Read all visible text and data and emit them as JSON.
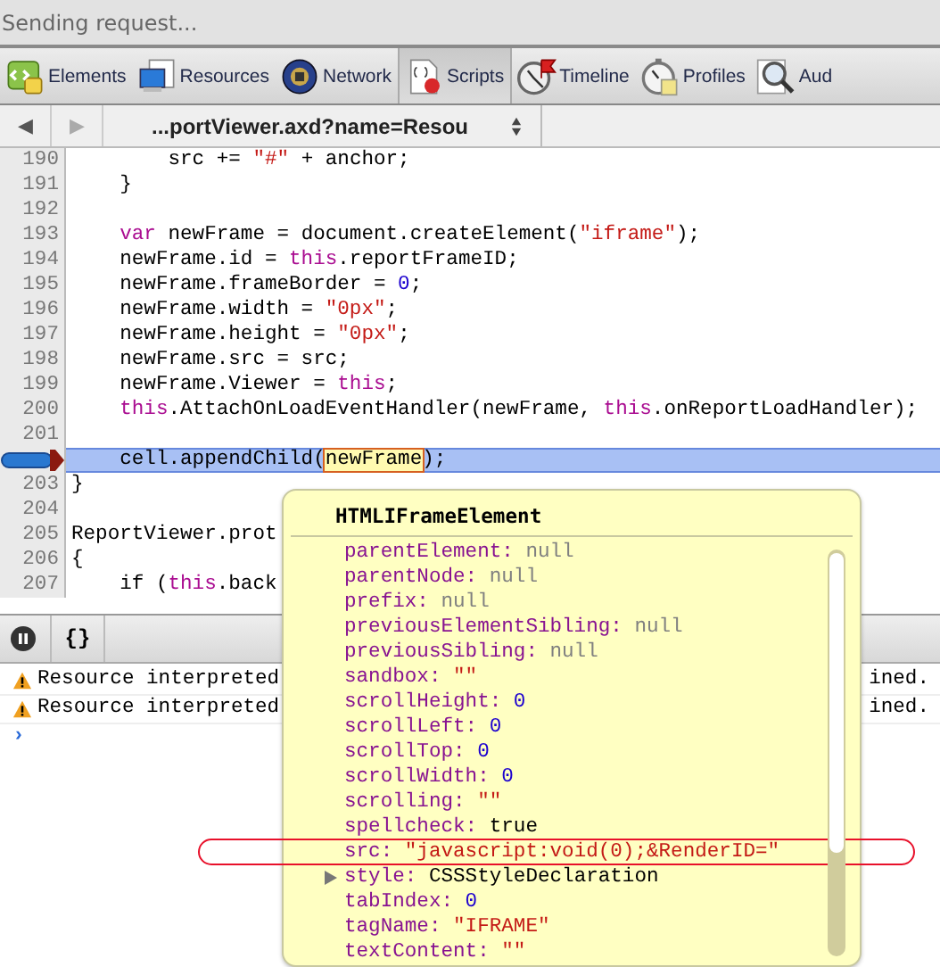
{
  "status_text": "Sending request...",
  "tabs": [
    {
      "label": "Elements",
      "selected": false
    },
    {
      "label": "Resources",
      "selected": false
    },
    {
      "label": "Network",
      "selected": false
    },
    {
      "label": "Scripts",
      "selected": true
    },
    {
      "label": "Timeline",
      "selected": false
    },
    {
      "label": "Profiles",
      "selected": false
    },
    {
      "label": "Aud",
      "selected": false
    }
  ],
  "nav": {
    "back": "◀",
    "forward": "▶",
    "file": "...portViewer.axd?name=Resou"
  },
  "code": {
    "lines": [
      {
        "number": "190",
        "current": false,
        "breakpoint": false,
        "segments": [
          {
            "text": "        src += ",
            "kind": "plain"
          },
          {
            "text": "\"#\"",
            "kind": "string"
          },
          {
            "text": " + anchor;",
            "kind": "plain"
          }
        ]
      },
      {
        "number": "191",
        "current": false,
        "breakpoint": false,
        "segments": [
          {
            "text": "    }",
            "kind": "plain"
          }
        ]
      },
      {
        "number": "192",
        "current": false,
        "breakpoint": false
      },
      {
        "number": "193",
        "current": false,
        "breakpoint": false,
        "segments": [
          {
            "text": "    var",
            "kind": "keyword"
          },
          {
            "text": " newFrame = document.createElement(",
            "kind": "plain"
          },
          {
            "text": "\"iframe\"",
            "kind": "string"
          },
          {
            "text": ");",
            "kind": "plain"
          }
        ]
      },
      {
        "number": "194",
        "current": false,
        "breakpoint": false,
        "segments": [
          {
            "text": "    newFrame.id = ",
            "kind": "plain"
          },
          {
            "text": "this",
            "kind": "keyword"
          },
          {
            "text": ".reportFrameID;",
            "kind": "plain"
          }
        ]
      },
      {
        "number": "195",
        "current": false,
        "breakpoint": false,
        "segments": [
          {
            "text": "    newFrame.frameBorder = ",
            "kind": "plain"
          },
          {
            "text": "0",
            "kind": "number"
          },
          {
            "text": ";",
            "kind": "plain"
          }
        ]
      },
      {
        "number": "196",
        "current": false,
        "breakpoint": false,
        "segments": [
          {
            "text": "    newFrame.width = ",
            "kind": "plain"
          },
          {
            "text": "\"0px\"",
            "kind": "string"
          },
          {
            "text": ";",
            "kind": "plain"
          }
        ]
      },
      {
        "number": "197",
        "current": false,
        "breakpoint": false,
        "segments": [
          {
            "text": "    newFrame.height = ",
            "kind": "plain"
          },
          {
            "text": "\"0px\"",
            "kind": "string"
          },
          {
            "text": ";",
            "kind": "plain"
          }
        ]
      },
      {
        "number": "198",
        "current": false,
        "breakpoint": false,
        "segments": [
          {
            "text": "    newFrame.src = src;",
            "kind": "plain"
          }
        ]
      },
      {
        "number": "199",
        "current": false,
        "breakpoint": false,
        "segments": [
          {
            "text": "    newFrame.Viewer = ",
            "kind": "plain"
          },
          {
            "text": "this",
            "kind": "keyword"
          },
          {
            "text": ";",
            "kind": "plain"
          }
        ]
      },
      {
        "number": "200",
        "current": false,
        "breakpoint": false,
        "segments": [
          {
            "text": "    this",
            "kind": "keyword"
          },
          {
            "text": ".AttachOnLoadEventHandler(newFrame, ",
            "kind": "plain"
          },
          {
            "text": "this",
            "kind": "keyword"
          },
          {
            "text": ".onReportLoadHandler);",
            "kind": "plain"
          }
        ]
      },
      {
        "number": "201",
        "current": false,
        "breakpoint": false
      },
      {
        "current": true,
        "breakpoint": true,
        "segments": [
          {
            "text": "    cell.appendChild(",
            "kind": "plain"
          },
          {
            "text": "newFrame",
            "kind": "hover"
          },
          {
            "text": ");",
            "kind": "plain"
          }
        ]
      },
      {
        "number": "203",
        "current": false,
        "breakpoint": false,
        "segments": [
          {
            "text": "}",
            "kind": "plain"
          }
        ]
      },
      {
        "number": "204",
        "current": false,
        "breakpoint": false
      },
      {
        "number": "205",
        "current": false,
        "breakpoint": false,
        "segments": [
          {
            "text": "ReportViewer.prot",
            "kind": "plain"
          }
        ]
      },
      {
        "number": "206",
        "current": false,
        "breakpoint": false,
        "segments": [
          {
            "text": "{",
            "kind": "plain"
          }
        ]
      },
      {
        "number": "207",
        "current": false,
        "breakpoint": false,
        "segments": [
          {
            "text": "    if (",
            "kind": "plain"
          },
          {
            "text": "this",
            "kind": "keyword"
          },
          {
            "text": ".back",
            "kind": "plain"
          }
        ]
      }
    ]
  },
  "console": {
    "braces": "{}",
    "messages": [
      {
        "kind": "warning",
        "text": "Resource interpreted",
        "tail": "ined."
      },
      {
        "kind": "warning",
        "text": "Resource interpreted",
        "tail": "ined."
      }
    ],
    "prompt": "›"
  },
  "popover": {
    "title": "HTMLIFrameElement",
    "properties": [
      {
        "name": "parentElement:",
        "value": "null",
        "kind": "null",
        "expandable": false,
        "circled": false
      },
      {
        "name": "parentNode:",
        "value": "null",
        "kind": "null",
        "expandable": false,
        "circled": false
      },
      {
        "name": "prefix:",
        "value": "null",
        "kind": "null",
        "expandable": false,
        "circled": false
      },
      {
        "name": "previousElementSibling:",
        "value": "null",
        "kind": "null",
        "expandable": false,
        "circled": false
      },
      {
        "name": "previousSibling:",
        "value": "null",
        "kind": "null",
        "expandable": false,
        "circled": false
      },
      {
        "name": "sandbox:",
        "value": "\"\"",
        "kind": "string",
        "expandable": false,
        "circled": false
      },
      {
        "name": "scrollHeight:",
        "value": "0",
        "kind": "number",
        "expandable": false,
        "circled": false
      },
      {
        "name": "scrollLeft:",
        "value": "0",
        "kind": "number",
        "expandable": false,
        "circled": false
      },
      {
        "name": "scrollTop:",
        "value": "0",
        "kind": "number",
        "expandable": false,
        "circled": false
      },
      {
        "name": "scrollWidth:",
        "value": "0",
        "kind": "number",
        "expandable": false,
        "circled": false
      },
      {
        "name": "scrolling:",
        "value": "\"\"",
        "kind": "string",
        "expandable": false,
        "circled": false
      },
      {
        "name": "spellcheck:",
        "value": "true",
        "kind": "bool",
        "expandable": false,
        "circled": false
      },
      {
        "name": "src:",
        "value": "\"javascript:void(0);&RenderID=\"",
        "kind": "string",
        "expandable": false,
        "circled": true
      },
      {
        "name": "style:",
        "value": "CSSStyleDeclaration",
        "kind": "object",
        "expandable": true,
        "circled": false
      },
      {
        "name": "tabIndex:",
        "value": "0",
        "kind": "number",
        "expandable": false,
        "circled": false
      },
      {
        "name": "tagName:",
        "value": "\"IFRAME\"",
        "kind": "string",
        "expandable": false,
        "circled": false
      },
      {
        "name": "textContent:",
        "value": "\"\"",
        "kind": "string",
        "expandable": false,
        "circled": false
      }
    ]
  }
}
